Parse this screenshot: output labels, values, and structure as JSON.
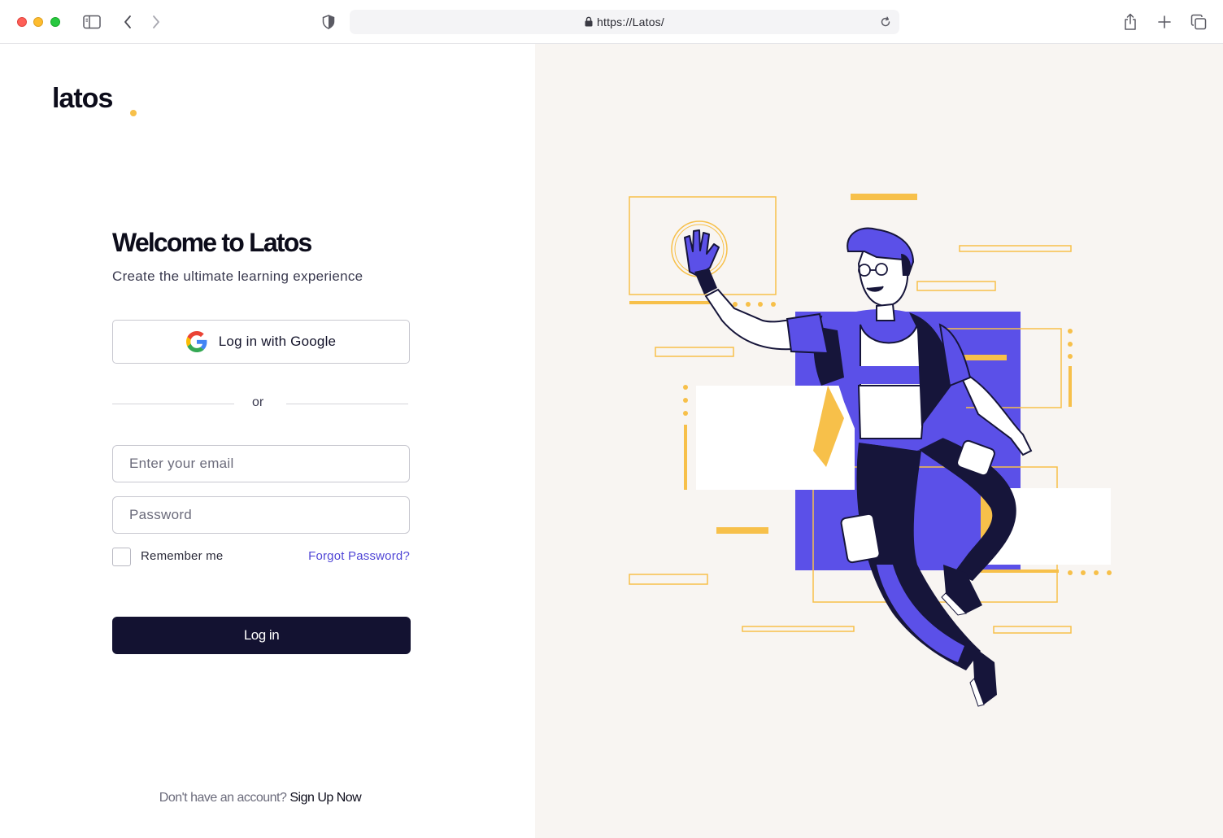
{
  "browser": {
    "url": "https://Latos/"
  },
  "brand": {
    "logo_text": "latos",
    "accent_color": "#f7c04a"
  },
  "login": {
    "title": "Welcome to Latos",
    "subtitle": "Create the ultimate learning experience",
    "google_button_label": "Log in with Google",
    "divider_text": "or",
    "email_placeholder": "Enter your email",
    "password_placeholder": "Password",
    "remember_label": "Remember me",
    "remember_checked": false,
    "forgot_label": "Forgot Password?",
    "submit_label": "Log in",
    "signup_question": "Don't have an account?",
    "signup_link": "Sign Up Now"
  },
  "colors": {
    "primary_dark": "#131231",
    "link_purple": "#5046d6",
    "illustration_purple": "#5b50e8",
    "illustration_yellow": "#f7c04a",
    "panel_bg": "#f8f5f2"
  },
  "icons": [
    "sidebar-icon",
    "back-icon",
    "forward-icon",
    "shield-icon",
    "lock-icon",
    "reload-icon",
    "share-icon",
    "new-tab-icon",
    "tabs-icon",
    "google-icon"
  ]
}
